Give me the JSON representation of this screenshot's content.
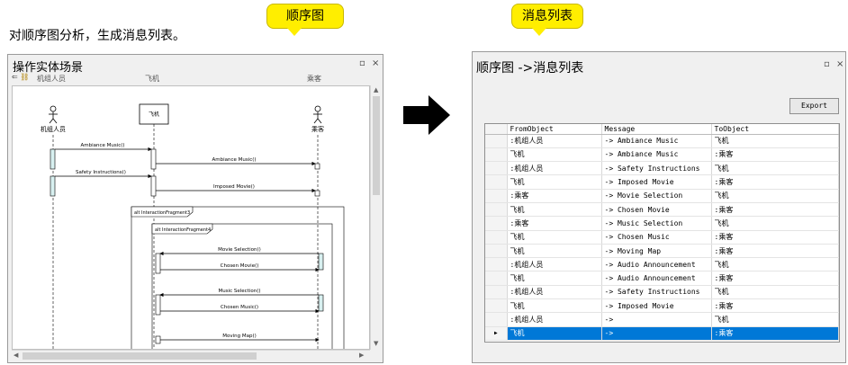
{
  "caption": "对顺序图分析，生成消息列表。",
  "callouts": {
    "sequence": "顺序图",
    "message_list": "消息列表"
  },
  "left_window": {
    "title": "操作实体场景",
    "lifelines": [
      "机组人员",
      "飞机",
      "乘客"
    ],
    "box_label": "飞机",
    "fragments": [
      "alt InteractionFragment3",
      "alt InteractionFragment4"
    ],
    "messages": [
      "Ambiance Music()",
      "Ambiance Music()",
      "Safety Instructions()",
      "Imposed Movie()",
      "Movie Selection()",
      "Chosen Movie()",
      "Music Selection()",
      "Chosen Music()",
      "Moving Map()"
    ]
  },
  "right_window": {
    "title": "顺序图 ->消息列表",
    "export_label": "Export",
    "columns": [
      "FromObject",
      "Message",
      "ToObject"
    ],
    "rows": [
      [
        ":机组人员",
        "-> Ambiance Music",
        "飞机"
      ],
      [
        "飞机",
        "-> Ambiance Music",
        ":乘客"
      ],
      [
        ":机组人员",
        "-> Safety Instructions",
        "飞机"
      ],
      [
        "飞机",
        "-> Imposed Movie",
        ":乘客"
      ],
      [
        ":乘客",
        "-> Movie Selection",
        "飞机"
      ],
      [
        "飞机",
        "-> Chosen Movie",
        ":乘客"
      ],
      [
        ":乘客",
        "-> Music Selection",
        "飞机"
      ],
      [
        "飞机",
        "-> Chosen Music",
        ":乘客"
      ],
      [
        "飞机",
        "-> Moving Map",
        ":乘客"
      ],
      [
        ":机组人员",
        "-> Audio Announcement",
        "飞机"
      ],
      [
        "飞机",
        "-> Audio Announcement",
        ":乘客"
      ],
      [
        ":机组人员",
        "-> Safety Instructions",
        "飞机"
      ],
      [
        "飞机",
        "-> Imposed Movie",
        ":乘客"
      ],
      [
        ":机组人员",
        "->",
        "飞机"
      ],
      [
        "飞机",
        "->",
        ":乘客"
      ]
    ],
    "selected_row": 14
  },
  "icons": {
    "close": "close-icon",
    "restore": "restore-icon",
    "arrow": "right-arrow-icon",
    "play": "row-indicator-icon"
  }
}
